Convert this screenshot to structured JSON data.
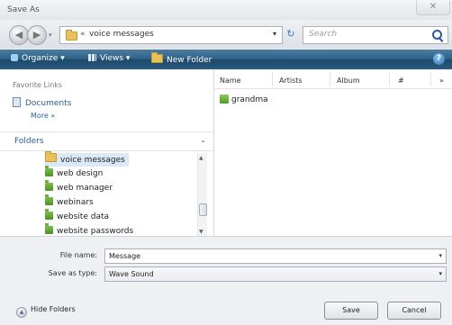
{
  "window": {
    "title": "Save As",
    "close_glyph": "✕"
  },
  "address": {
    "separator": "«",
    "current": "voice messages",
    "search_placeholder": "Search",
    "back_glyph": "◀",
    "forward_glyph": "▶",
    "dropdown_glyph": "▾"
  },
  "toolbar": {
    "organize": "Organize",
    "views": "Views",
    "new_folder": "New Folder",
    "help_glyph": "?",
    "menu_glyph": "▾"
  },
  "nav": {
    "favorites_title": "Favorite Links",
    "documents": "Documents",
    "more": "More »",
    "folders_label": "Folders",
    "tree": [
      {
        "label": "voice messages",
        "icon": "folder-icon",
        "selected": true
      },
      {
        "label": "web design",
        "icon": "green-folder-icon",
        "selected": false
      },
      {
        "label": "web manager",
        "icon": "green-folder-icon",
        "selected": false
      },
      {
        "label": "webinars",
        "icon": "green-folder-icon",
        "selected": false
      },
      {
        "label": "website data",
        "icon": "green-folder-icon",
        "selected": false
      },
      {
        "label": "website passwords",
        "icon": "green-folder-icon",
        "selected": false
      }
    ]
  },
  "filelist": {
    "columns": [
      "Name",
      "Artists",
      "Album",
      "#",
      "»"
    ],
    "files": [
      {
        "name": "grandma",
        "icon": "audio-file-icon"
      }
    ]
  },
  "form": {
    "filename_label": "File name:",
    "filename_value": "Message",
    "type_label": "Save as type:",
    "type_value": "Wave Sound"
  },
  "buttons": {
    "hide_folders": "Hide Folders",
    "save": "Save",
    "cancel": "Cancel"
  },
  "colors": {
    "toolbar": "#2c5d83",
    "link": "#2c5d9b",
    "selection": "#dbe9f6"
  }
}
